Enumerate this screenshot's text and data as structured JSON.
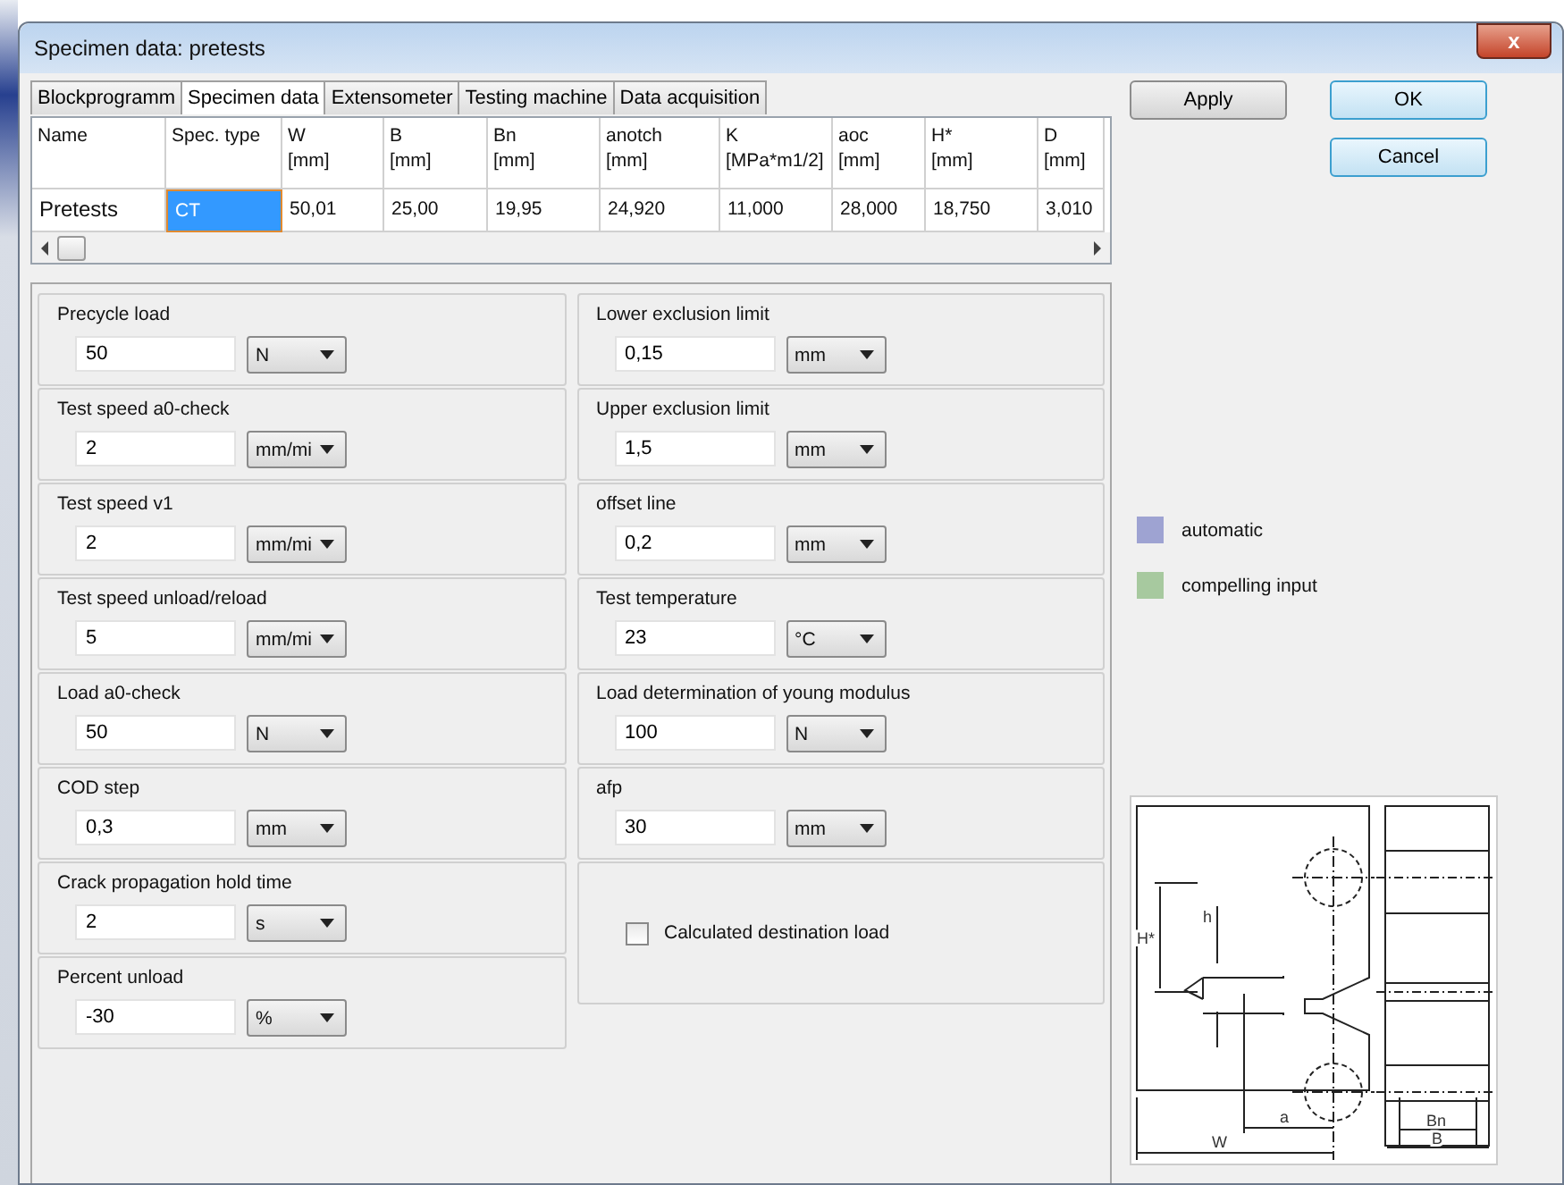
{
  "window": {
    "title": "Specimen data: pretests",
    "close": "x"
  },
  "tabs": [
    {
      "label": "Blockprogramm",
      "selected": false
    },
    {
      "label": "Specimen data",
      "selected": true
    },
    {
      "label": "Extensometer",
      "selected": false
    },
    {
      "label": "Testing machine",
      "selected": false
    },
    {
      "label": "Data acquisition",
      "selected": false
    }
  ],
  "buttons": {
    "apply": "Apply",
    "ok": "OK",
    "cancel": "Cancel"
  },
  "table": {
    "columns": [
      {
        "name": "Name"
      },
      {
        "name": "Spec. type"
      },
      {
        "name": "W",
        "unit": "[mm]"
      },
      {
        "name": "B",
        "unit": "[mm]"
      },
      {
        "name": "Bn",
        "unit": "[mm]"
      },
      {
        "name": "anotch",
        "unit": "[mm]"
      },
      {
        "name": "K",
        "unit": "[MPa*m1/2]"
      },
      {
        "name": "aoc",
        "unit": "[mm]"
      },
      {
        "name": "H*",
        "unit": "[mm]"
      },
      {
        "name": "D",
        "unit": "[mm]"
      }
    ],
    "rows": [
      [
        {
          "text": "Pretests",
          "selected": false
        },
        {
          "text": "CT",
          "selected": true
        },
        {
          "text": "50,01",
          "selected": false
        },
        {
          "text": "25,00",
          "selected": false
        },
        {
          "text": "19,95",
          "selected": false
        },
        {
          "text": "24,920",
          "selected": false
        },
        {
          "text": "11,000",
          "selected": false
        },
        {
          "text": "28,000",
          "selected": false
        },
        {
          "text": "18,750",
          "selected": false
        },
        {
          "text": "3,010",
          "selected": false
        }
      ]
    ]
  },
  "left_fields": [
    {
      "label": "Precycle load",
      "value": "50",
      "unit": "N"
    },
    {
      "label": "Test speed a0-check",
      "value": "2",
      "unit": "mm/mi"
    },
    {
      "label": "Test speed v1",
      "value": "2",
      "unit": "mm/mi"
    },
    {
      "label": "Test speed unload/reload",
      "value": "5",
      "unit": "mm/mi"
    },
    {
      "label": "Load a0-check",
      "value": "50",
      "unit": "N"
    },
    {
      "label": "COD step",
      "value": "0,3",
      "unit": "mm"
    },
    {
      "label": "Crack propagation hold time",
      "value": "2",
      "unit": "s"
    },
    {
      "label": "Percent unload",
      "value": "-30",
      "unit": "%"
    }
  ],
  "right_fields": [
    {
      "label": "Lower exclusion limit",
      "value": "0,15",
      "unit": "mm"
    },
    {
      "label": "Upper exclusion limit",
      "value": "1,5",
      "unit": "mm"
    },
    {
      "label": "offset line",
      "value": "0,2",
      "unit": "mm"
    },
    {
      "label": "Test temperature",
      "value": "23",
      "unit": "°C"
    },
    {
      "label": "Load determination of young modulus",
      "value": "100",
      "unit": "N"
    },
    {
      "label": "afp",
      "value": "30",
      "unit": "mm"
    }
  ],
  "checkbox": {
    "label": "Calculated destination load",
    "checked": false
  },
  "legend": [
    {
      "label": "automatic",
      "color": "#9ea3d2"
    },
    {
      "label": "compelling input",
      "color": "#a7c99f"
    }
  ],
  "diagram": {
    "labels": {
      "hstar": "H*",
      "h": "h",
      "a": "a",
      "w": "W",
      "bn": "Bn",
      "b": "B"
    }
  }
}
